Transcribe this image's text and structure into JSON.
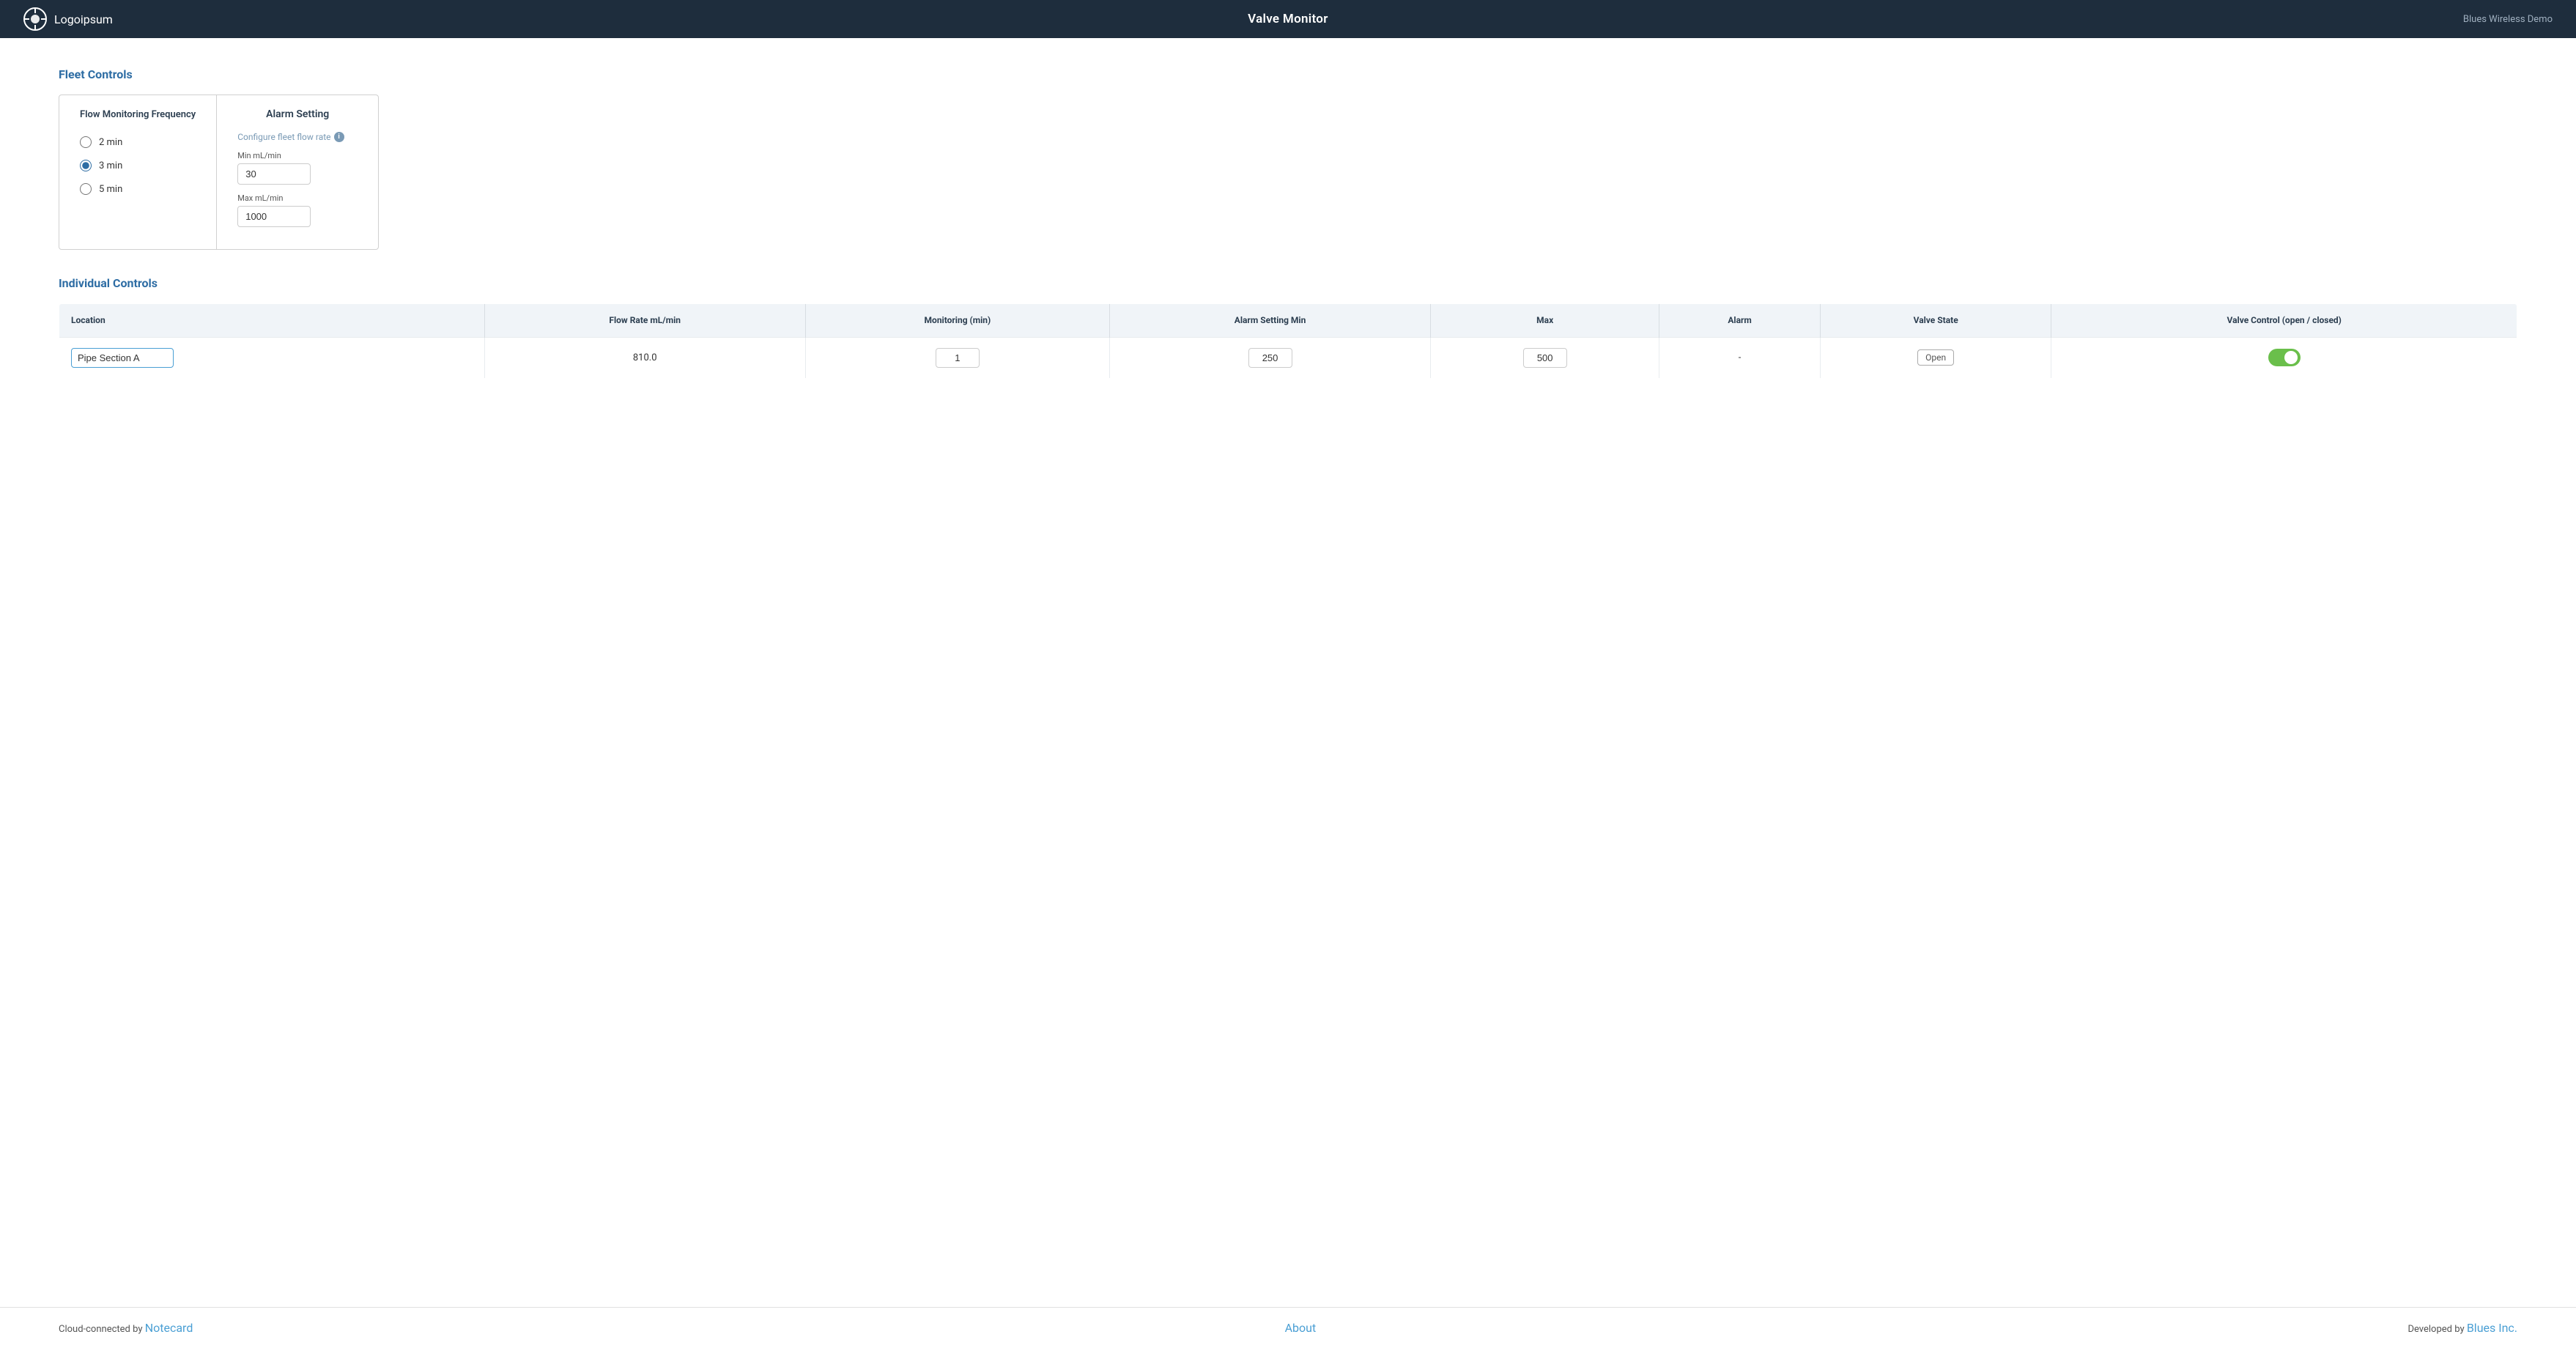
{
  "header": {
    "logo_text": "Logoipsum",
    "title": "Valve Monitor",
    "brand": "Blues Wireless Demo"
  },
  "fleet_controls": {
    "section_title": "Fleet Controls",
    "frequency_panel": {
      "title": "Flow Monitoring Frequency",
      "options": [
        {
          "label": "2 min",
          "value": "2",
          "checked": false
        },
        {
          "label": "3 min",
          "value": "3",
          "checked": true
        },
        {
          "label": "5 min",
          "value": "5",
          "checked": false
        }
      ]
    },
    "alarm_panel": {
      "title": "Alarm Setting",
      "config_label": "Configure fleet flow rate",
      "min_label": "Min mL/min",
      "min_value": "30",
      "max_label": "Max mL/min",
      "max_value": "1000"
    }
  },
  "individual_controls": {
    "section_title": "Individual Controls",
    "table_headers": {
      "location": "Location",
      "flow_rate": "Flow Rate mL/min",
      "monitoring": "Monitoring (min)",
      "alarm_min": "Alarm Setting Min",
      "alarm_max": "Max",
      "alarm": "Alarm",
      "valve_state": "Valve State",
      "valve_control": "Valve Control (open / closed)"
    },
    "rows": [
      {
        "location": "Pipe Section A",
        "flow_rate": "810.0",
        "monitoring": "1",
        "alarm_min": "250",
        "alarm_max": "500",
        "alarm": "-",
        "valve_state": "Open",
        "valve_open": true
      }
    ]
  },
  "footer": {
    "cloud_text": "Cloud-connected by ",
    "notecard_link": "Notecard",
    "about_link": "About",
    "developed_text": "Developed by ",
    "blues_link": "Blues Inc."
  }
}
